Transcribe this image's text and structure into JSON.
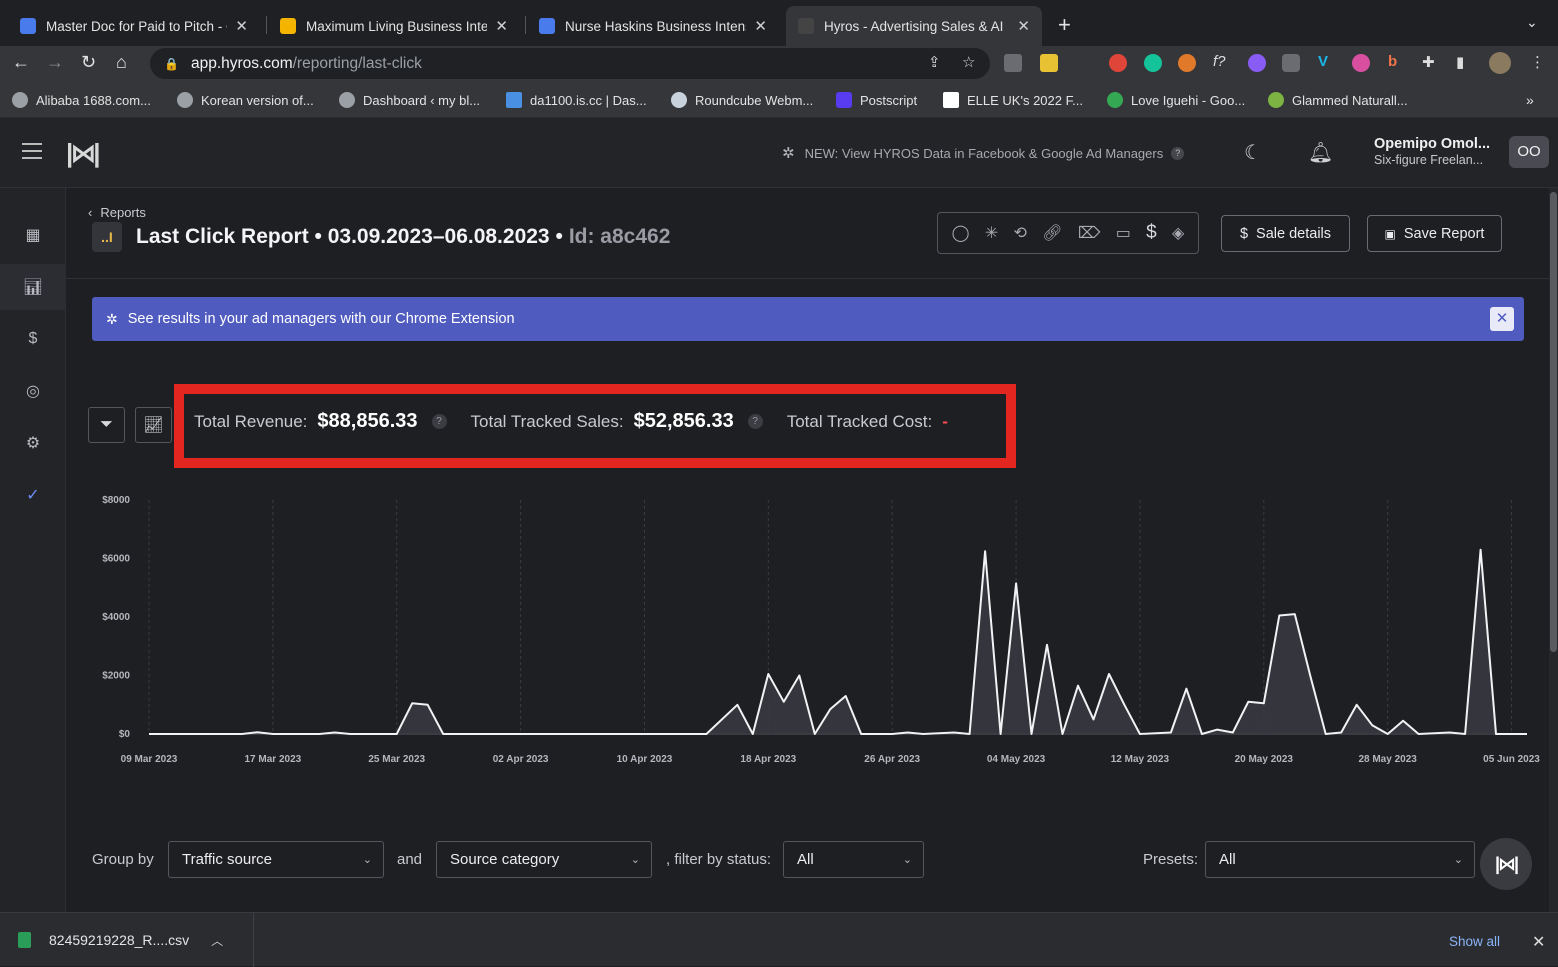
{
  "browser": {
    "tabs": [
      {
        "title": "Master Doc for Paid to Pitch - C",
        "favicon_color": "#4a7bec"
      },
      {
        "title": "Maximum Living Business Inter",
        "favicon_color": "#f4b400"
      },
      {
        "title": "Nurse Haskins Business Intens",
        "favicon_color": "#4a7bec"
      },
      {
        "title": "Hyros - Advertising Sales & AI",
        "favicon_color": "#444444"
      }
    ],
    "url_host": "app.hyros.com",
    "url_path": "/reporting/last-click",
    "bookmarks": [
      "Alibaba 1688.com...",
      "Korean version of...",
      "Dashboard ‹ my bl...",
      "da1100.is.cc | Das...",
      "Roundcube Webm...",
      "Postscript",
      "ELLE UK's 2022 F...",
      "Love Iguehi - Goo...",
      "Glammed Naturall..."
    ]
  },
  "header": {
    "announcement": "NEW: View HYROS Data in Facebook & Google Ad Managers",
    "user_name": "Opemipo Omol...",
    "user_subtitle": "Six-figure Freelan...",
    "avatar_initials": "OO"
  },
  "report": {
    "breadcrumb": "Reports",
    "title_icon": "..I",
    "title": "Last Click Report • 03.09.2023–06.08.2023 •",
    "id_label": "Id: a8c462",
    "sale_details_label": "Sale details",
    "save_report_label": "Save Report"
  },
  "banner": {
    "text": "See results in your ad managers with our Chrome Extension"
  },
  "totals": {
    "revenue_label": "Total Revenue:",
    "revenue_value": "$88,856.33",
    "sales_label": "Total Tracked Sales:",
    "sales_value": "$52,856.33",
    "cost_label": "Total Tracked Cost:",
    "cost_value": "-"
  },
  "chart_data": {
    "type": "area",
    "y_ticks": [
      "$8000",
      "$6000",
      "$4000",
      "$2000",
      "$0"
    ],
    "ylim": [
      0,
      8000
    ],
    "x_ticks": [
      "09 Mar 2023",
      "17 Mar 2023",
      "25 Mar 2023",
      "02 Apr 2023",
      "10 Apr 2023",
      "18 Apr 2023",
      "26 Apr 2023",
      "04 May 2023",
      "12 May 2023",
      "20 May 2023",
      "28 May 2023",
      "05 Jun 2023"
    ],
    "x_start": "09 Mar 2023",
    "x_end": "06 Jun 2023",
    "values": [
      0,
      0,
      0,
      0,
      0,
      0,
      0,
      50,
      0,
      0,
      0,
      50,
      0,
      0,
      0,
      0,
      0,
      1050,
      1000,
      0,
      0,
      0,
      0,
      0,
      0,
      0,
      0,
      0,
      0,
      0,
      0,
      0,
      0,
      0,
      0,
      0,
      0,
      0,
      0,
      0,
      0,
      0,
      0,
      0,
      0,
      0,
      0,
      0,
      0,
      0,
      0,
      0,
      0,
      0,
      0,
      0,
      0,
      0,
      0,
      0,
      0,
      0,
      0,
      0,
      0,
      0,
      0,
      0,
      0,
      0,
      0,
      0,
      0,
      0,
      0,
      0,
      0,
      0,
      0,
      0,
      0,
      0,
      0,
      0,
      0,
      0,
      0,
      0,
      0,
      0,
      0,
      0,
      0,
      0,
      0,
      0,
      0,
      0,
      0,
      0,
      0,
      0,
      0,
      0,
      0,
      0,
      0,
      0,
      0,
      0,
      0,
      0,
      0,
      0,
      0,
      0,
      0,
      0,
      0,
      0,
      0,
      0,
      0,
      0,
      0,
      0,
      0,
      0,
      0,
      0,
      0,
      0,
      0,
      0
    ],
    "series": [
      {
        "points": [
          [
            "09 Mar 2023",
            0
          ],
          [
            "15 Mar 2023",
            0
          ],
          [
            "16 Mar 2023",
            60
          ],
          [
            "17 Mar 2023",
            0
          ],
          [
            "20 Mar 2023",
            0
          ],
          [
            "21 Mar 2023",
            50
          ],
          [
            "22 Mar 2023",
            0
          ],
          [
            "25 Mar 2023",
            0
          ],
          [
            "26 Mar 2023",
            1050
          ],
          [
            "27 Mar 2023",
            1000
          ],
          [
            "28 Mar 2023",
            0
          ],
          [
            "14 Apr 2023",
            0
          ],
          [
            "16 Apr 2023",
            1000
          ],
          [
            "17 Apr 2023",
            0
          ],
          [
            "18 Apr 2023",
            2050
          ],
          [
            "19 Apr 2023",
            1100
          ],
          [
            "20 Apr 2023",
            2000
          ],
          [
            "21 Apr 2023",
            0
          ],
          [
            "22 Apr 2023",
            850
          ],
          [
            "23 Apr 2023",
            1300
          ],
          [
            "24 Apr 2023",
            0
          ],
          [
            "26 Apr 2023",
            0
          ],
          [
            "27 Apr 2023",
            50
          ],
          [
            "28 Apr 2023",
            0
          ],
          [
            "30 Apr 2023",
            50
          ],
          [
            "01 May 2023",
            0
          ],
          [
            "02 May 2023",
            6250
          ],
          [
            "03 May 2023",
            0
          ],
          [
            "04 May 2023",
            5150
          ],
          [
            "05 May 2023",
            0
          ],
          [
            "06 May 2023",
            3050
          ],
          [
            "07 May 2023",
            0
          ],
          [
            "08 May 2023",
            1650
          ],
          [
            "09 May 2023",
            500
          ],
          [
            "10 May 2023",
            2050
          ],
          [
            "11 May 2023",
            1000
          ],
          [
            "12 May 2023",
            0
          ],
          [
            "14 May 2023",
            50
          ],
          [
            "15 May 2023",
            1550
          ],
          [
            "16 May 2023",
            0
          ],
          [
            "17 May 2023",
            150
          ],
          [
            "18 May 2023",
            50
          ],
          [
            "19 May 2023",
            1100
          ],
          [
            "20 May 2023",
            1050
          ],
          [
            "21 May 2023",
            4050
          ],
          [
            "22 May 2023",
            4100
          ],
          [
            "23 May 2023",
            2000
          ],
          [
            "24 May 2023",
            0
          ],
          [
            "25 May 2023",
            50
          ],
          [
            "26 May 2023",
            1000
          ],
          [
            "27 May 2023",
            300
          ],
          [
            "28 May 2023",
            0
          ],
          [
            "29 May 2023",
            450
          ],
          [
            "30 May 2023",
            0
          ],
          [
            "01 Jun 2023",
            50
          ],
          [
            "02 Jun 2023",
            0
          ],
          [
            "03 Jun 2023",
            6300
          ],
          [
            "04 Jun 2023",
            0
          ],
          [
            "06 Jun 2023",
            0
          ]
        ]
      }
    ],
    "grid": "vertical dashed"
  },
  "grouping": {
    "group_by_label": "Group by",
    "group_by_value": "Traffic source",
    "and_label": "and",
    "and_value": "Source category",
    "status_label": ", filter by status:",
    "status_value": "All",
    "presets_label": "Presets:",
    "presets_value": "All"
  },
  "download": {
    "filename": "82459219228_R....csv",
    "show_all_label": "Show all"
  }
}
